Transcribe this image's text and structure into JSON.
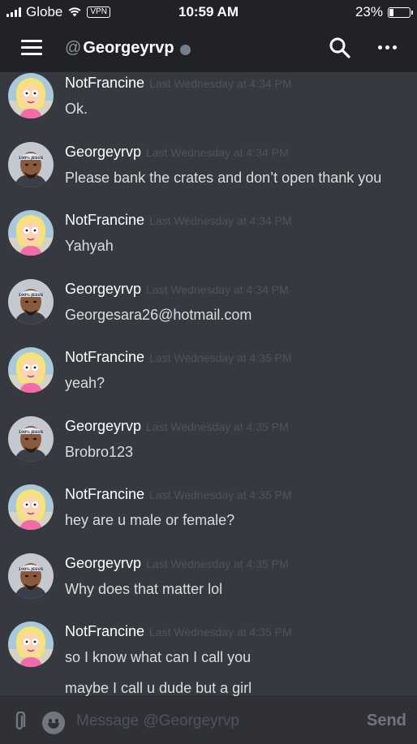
{
  "status_bar": {
    "carrier": "Globe",
    "vpn": "VPN",
    "time": "10:59 AM",
    "battery_percent": "23%",
    "battery_level": 0.23
  },
  "header": {
    "at_symbol": "@",
    "channel_name": "Georgeyrvp",
    "presence_color": "#747f8d"
  },
  "messages": [
    {
      "author": "NotFrancine",
      "timestamp": "Last Wednesday at 4:34 PM",
      "lines": [
        "Ok."
      ],
      "avatar": "francine-avatar"
    },
    {
      "author": "Georgeyrvp",
      "timestamp": "Last Wednesday at 4:34 PM",
      "lines": [
        "Please bank the crates and don’t open thank you"
      ],
      "avatar": "georgey-avatar"
    },
    {
      "author": "NotFrancine",
      "timestamp": "Last Wednesday at 4:34 PM",
      "lines": [
        "Yahyah"
      ],
      "avatar": "francine-avatar"
    },
    {
      "author": "Georgeyrvp",
      "timestamp": "Last Wednesday at 4:34 PM",
      "lines": [
        "Georgesara26@hotmail.com"
      ],
      "avatar": "georgey-avatar"
    },
    {
      "author": "NotFrancine",
      "timestamp": "Last Wednesday at 4:35 PM",
      "lines": [
        "yeah?"
      ],
      "avatar": "francine-avatar"
    },
    {
      "author": "Georgeyrvp",
      "timestamp": "Last Wednesday at 4:35 PM",
      "lines": [
        "Brobro123"
      ],
      "avatar": "georgey-avatar"
    },
    {
      "author": "NotFrancine",
      "timestamp": "Last Wednesday at 4:35 PM",
      "lines": [
        "hey are u male or female?"
      ],
      "avatar": "francine-avatar"
    },
    {
      "author": "Georgeyrvp",
      "timestamp": "Last Wednesday at 4:35 PM",
      "lines": [
        "Why does that matter lol"
      ],
      "avatar": "georgey-avatar"
    },
    {
      "author": "NotFrancine",
      "timestamp": "Last Wednesday at 4:35 PM",
      "lines": [
        "so I know what can I call you",
        "maybe I call u dude but a girl"
      ],
      "avatar": "francine-avatar"
    }
  ],
  "input": {
    "placeholder": "Message @Georgeyrvp",
    "value": "",
    "send_label": "Send"
  },
  "colors": {
    "background": "#36393f",
    "header": "#202225",
    "timestamp": "#4f545c"
  }
}
